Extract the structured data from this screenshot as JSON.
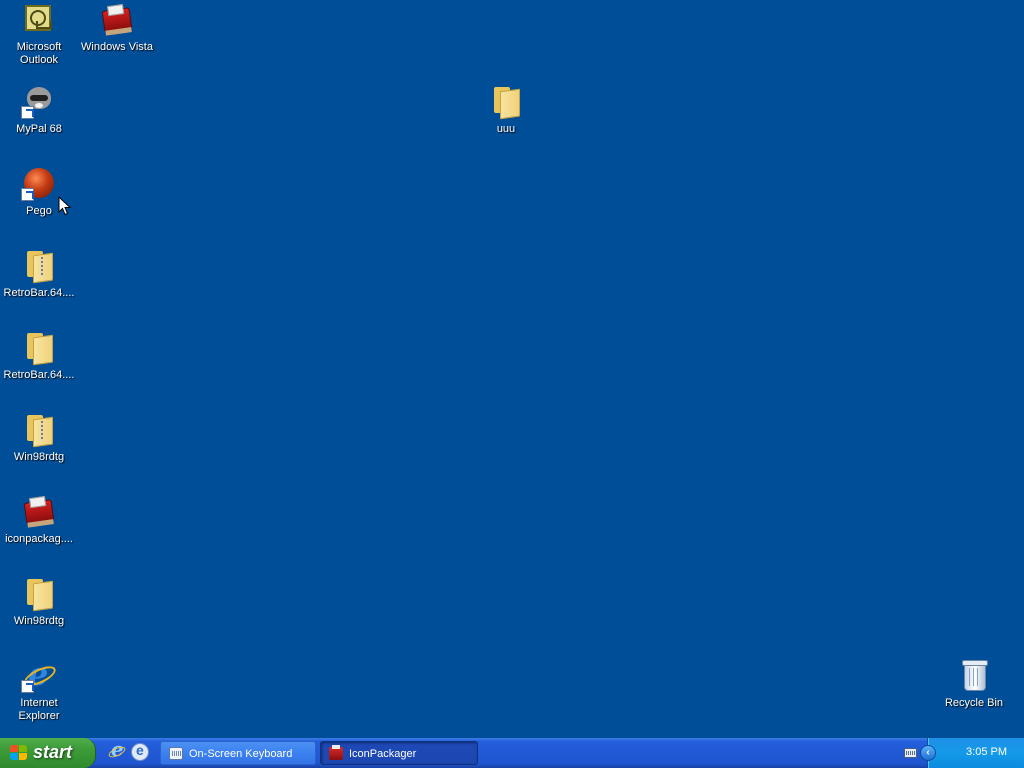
{
  "desktop": {
    "icons": [
      {
        "label": "Microsoft Outlook",
        "icon": "outlook-icon"
      },
      {
        "label": "Windows Vista",
        "icon": "iconpackager-box-icon"
      },
      {
        "label": "MyPal 68",
        "icon": "mypal-raccoon-icon"
      },
      {
        "label": "Pego",
        "icon": "pego-ball-icon"
      },
      {
        "label": "RetroBar.64....",
        "icon": "zip-folder-icon"
      },
      {
        "label": "RetroBar.64....",
        "icon": "folder-icon"
      },
      {
        "label": "Win98rdtg",
        "icon": "zip-folder-icon"
      },
      {
        "label": "iconpackag....",
        "icon": "iconpackager-box-icon"
      },
      {
        "label": "Win98rdtg",
        "icon": "folder-icon"
      },
      {
        "label": "Internet Explorer",
        "icon": "internet-explorer-icon"
      },
      {
        "label": "uuu",
        "icon": "folder-icon"
      },
      {
        "label": "Recycle Bin",
        "icon": "recycle-bin-icon"
      }
    ],
    "background_color": "#004e98"
  },
  "taskbar": {
    "start_label": "start",
    "quick_launch": [
      {
        "icon": "internet-explorer-icon"
      },
      {
        "icon": "outlook-express-icon"
      }
    ],
    "tasks": [
      {
        "label": "On-Screen Keyboard",
        "icon": "keyboard-icon",
        "active": false
      },
      {
        "label": "IconPackager",
        "icon": "iconpackager-box-icon",
        "active": true
      }
    ],
    "tray": {
      "icons": [
        "keyboard-icon",
        "show-hidden-icons-chevron-icon"
      ],
      "clock": "3:05 PM"
    }
  }
}
